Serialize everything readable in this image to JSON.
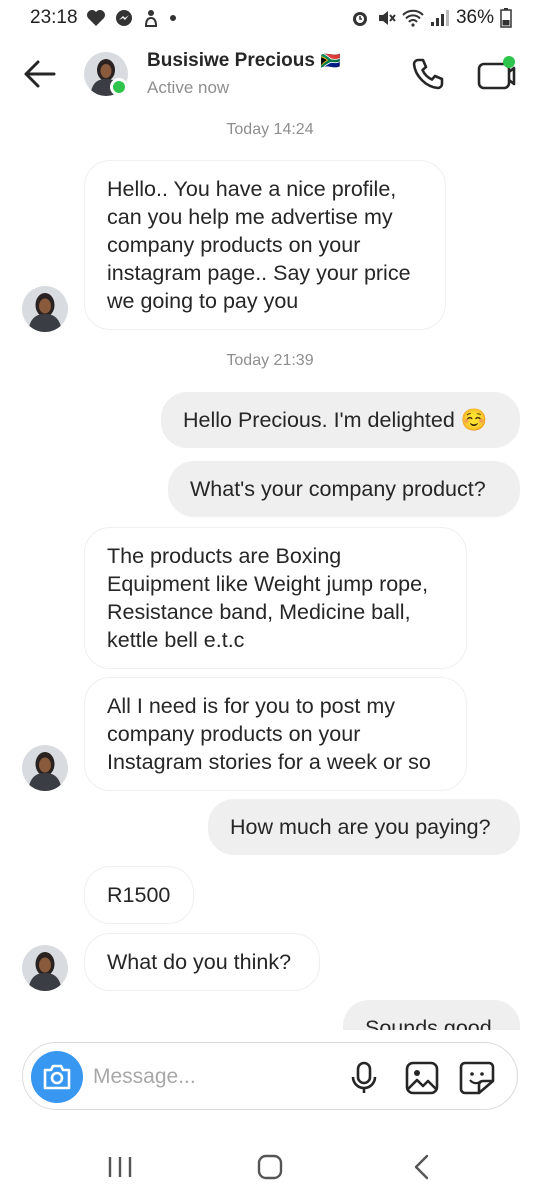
{
  "status_bar": {
    "time": "23:18",
    "battery": "36%"
  },
  "header": {
    "name": "Busisiwe Precious",
    "flag": "🇿🇦",
    "status": "Active now"
  },
  "colors": {
    "accent": "#3897f0",
    "online": "#2fc44b",
    "sent_bubble": "#efefef",
    "meta_text": "#8e8e8e"
  },
  "messages": {
    "timestamp_1": "Today 14:24",
    "m1": "Hello.. You have a nice profile, can you help me advertise my company products on your instagram page.. Say your price we going to pay you",
    "timestamp_2": "Today 21:39",
    "m2": "Hello Precious. I'm delighted ☺️",
    "m3": "What's your company product?",
    "m4": "The products are Boxing Equipment like Weight jump rope, Resistance band, Medicine ball, kettle bell e.t.c",
    "m5": "All I need is for you to post my company products on your Instagram stories for a week or so",
    "m6": "How much are you paying?",
    "m7": "R1500",
    "m8": "What do you think?",
    "m9": "Sounds good"
  },
  "composer": {
    "placeholder": "Message..."
  },
  "icons": {
    "back": "arrow-left-icon",
    "call": "phone-icon",
    "video": "video-camera-icon",
    "camera": "camera-icon",
    "mic": "microphone-icon",
    "gallery": "image-icon",
    "sticker": "sticker-icon"
  }
}
